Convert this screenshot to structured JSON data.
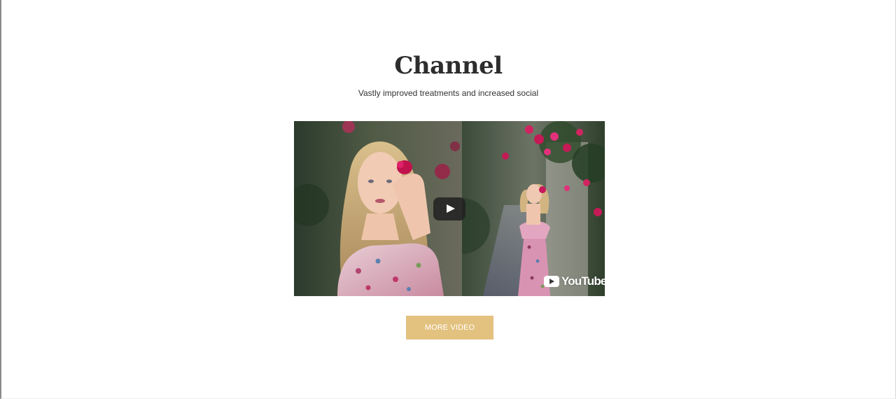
{
  "section": {
    "title": "Channel",
    "subtitle": "Vastly improved treatments and increased social"
  },
  "video": {
    "play_icon": "play-icon",
    "brand_icon": "youtube-icon",
    "brand_label": "YouTube"
  },
  "cta": {
    "label": "MORE VIDEO",
    "color": "#e3c17f"
  },
  "colors": {
    "heading": "#2d2d2d",
    "text": "#333333",
    "background": "#ffffff"
  }
}
